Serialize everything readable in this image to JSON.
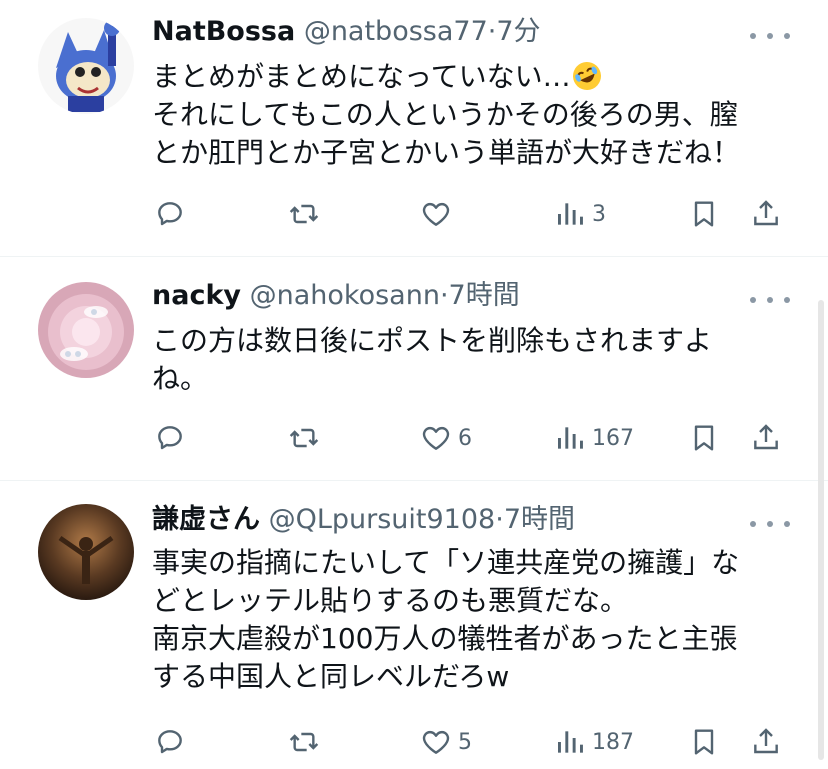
{
  "posts": [
    {
      "name": "NatBossa",
      "handle": "@natbossa77",
      "separator": "·",
      "time": "7分",
      "lines": [
        "まとめがまとめになっていない…",
        "それにしてもこの人というかその後ろの男、膣",
        "とか肛門とか子宮とかいう単語が大好きだね！"
      ],
      "emoji_icon": "rolling-on-floor-laughing-emoji",
      "actions": {
        "reply": "",
        "repost": "",
        "like": "",
        "views": "3"
      }
    },
    {
      "name": "nacky",
      "handle": "@nahokosann",
      "separator": "·",
      "time": "7時間",
      "lines": [
        "この方は数日後にポストを削除もされますよ",
        "ね。"
      ],
      "actions": {
        "reply": "",
        "repost": "",
        "like": "6",
        "views": "167"
      }
    },
    {
      "name": "謙虚さん",
      "handle": "@QLpursuit9108",
      "separator": "·",
      "time": "7時間",
      "lines": [
        "事実の指摘にたいして「ソ連共産党の擁護」な",
        "どとレッテル貼りするのも悪質だな。",
        "南京大虐殺が100万人の犠牲者があったと主張",
        "する中国人と同レベルだろw"
      ],
      "actions": {
        "reply": "",
        "repost": "",
        "like": "5",
        "views": "187"
      }
    }
  ],
  "icons": [
    "more-icon",
    "reply-icon",
    "repost-icon",
    "like-icon",
    "views-icon",
    "bookmark-icon",
    "share-icon"
  ],
  "colors": {
    "text": "#0f1419",
    "secondary": "#536471",
    "divider": "#eff3f4"
  }
}
